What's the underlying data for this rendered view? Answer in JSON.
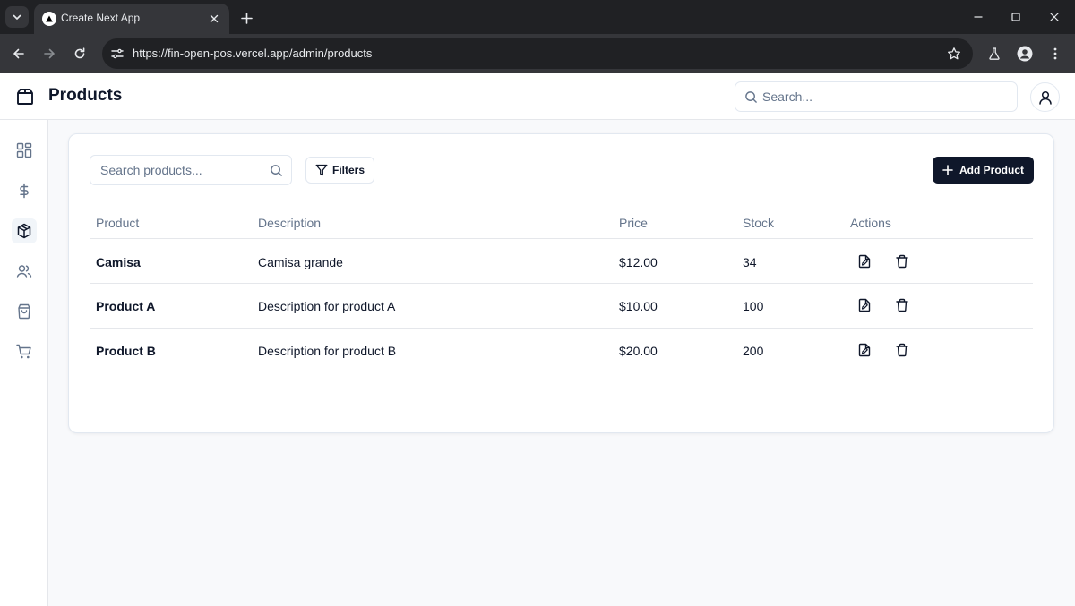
{
  "browser": {
    "tab_title": "Create Next App",
    "url": "https://fin-open-pos.vercel.app/admin/products"
  },
  "header": {
    "title": "Products",
    "search_placeholder": "Search..."
  },
  "sidebar": {
    "items": [
      {
        "name": "dashboard",
        "icon": "layout-grid-icon",
        "active": false
      },
      {
        "name": "finance",
        "icon": "dollar-icon",
        "active": false
      },
      {
        "name": "products",
        "icon": "package-icon",
        "active": true
      },
      {
        "name": "customers",
        "icon": "users-icon",
        "active": false
      },
      {
        "name": "orders",
        "icon": "shopping-bag-icon",
        "active": false
      },
      {
        "name": "pos",
        "icon": "shopping-cart-icon",
        "active": false
      }
    ]
  },
  "toolbar": {
    "search_placeholder": "Search products...",
    "filters_label": "Filters",
    "add_label": "Add Product"
  },
  "table": {
    "columns": [
      "Product",
      "Description",
      "Price",
      "Stock",
      "Actions"
    ],
    "rows": [
      {
        "name": "Camisa",
        "description": "Camisa grande",
        "price": "$12.00",
        "stock": "34"
      },
      {
        "name": "Product A",
        "description": "Description for product A",
        "price": "$10.00",
        "stock": "100"
      },
      {
        "name": "Product B",
        "description": "Description for product B",
        "price": "$20.00",
        "stock": "200"
      }
    ]
  },
  "colors": {
    "primary": "#0f172a",
    "muted_text": "#64748b",
    "border": "#e2e8f0",
    "chrome_dark": "#202124",
    "chrome_mid": "#35363a"
  }
}
